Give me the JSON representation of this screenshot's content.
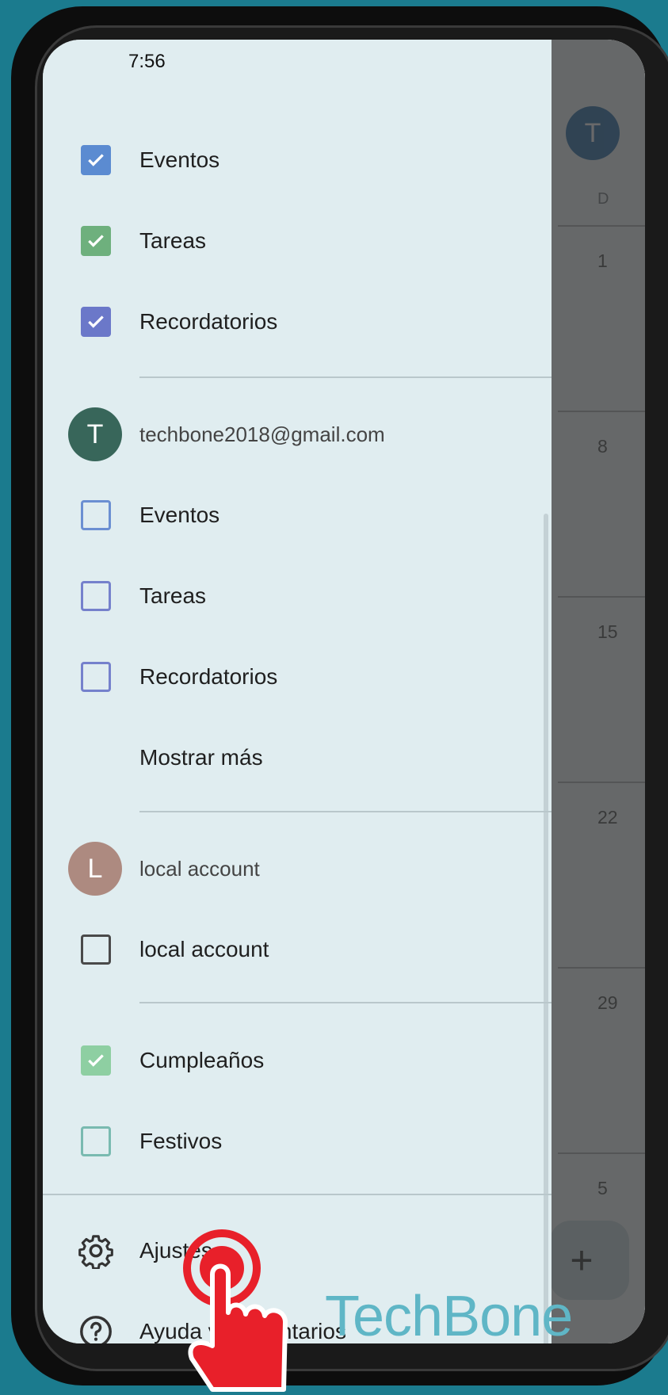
{
  "status_bar": {
    "time": "7:56"
  },
  "calendar": {
    "avatar_letter": "T",
    "weekday_header": "D",
    "days": [
      "1",
      "8",
      "15",
      "22",
      "29",
      "5"
    ],
    "fab_icon": "plus-icon"
  },
  "drawer": {
    "top_calendars": [
      {
        "label": "Eventos",
        "checked": true,
        "color": "#5b8bd1"
      },
      {
        "label": "Tareas",
        "checked": true,
        "color": "#6eb07d"
      },
      {
        "label": "Recordatorios",
        "checked": true,
        "color": "#6b78c9"
      }
    ],
    "account_1": {
      "avatar_letter": "T",
      "email": "techbone2018@gmail.com",
      "avatar_color": "#38665a",
      "calendars": [
        {
          "label": "Eventos",
          "checked": false,
          "color": "#6b8fd2"
        },
        {
          "label": "Tareas",
          "checked": false,
          "color": "#7581cc"
        },
        {
          "label": "Recordatorios",
          "checked": false,
          "color": "#7581cc"
        }
      ],
      "show_more": "Mostrar más"
    },
    "account_2": {
      "avatar_letter": "L",
      "name": "local account",
      "avatar_color": "#ad8a80",
      "calendars": [
        {
          "label": "local account",
          "checked": false,
          "color": "#4a4a4a"
        }
      ]
    },
    "other_calendars": [
      {
        "label": "Cumpleaños",
        "checked": true,
        "color": "#8ecfa2"
      },
      {
        "label": "Festivos",
        "checked": false,
        "color": "#79bab0"
      }
    ],
    "menu": [
      {
        "label": "Ajustes",
        "icon": "gear-icon"
      },
      {
        "label": "Ayuda y comentarios",
        "icon": "help-icon"
      }
    ]
  },
  "watermark": {
    "text": "TechBone"
  }
}
